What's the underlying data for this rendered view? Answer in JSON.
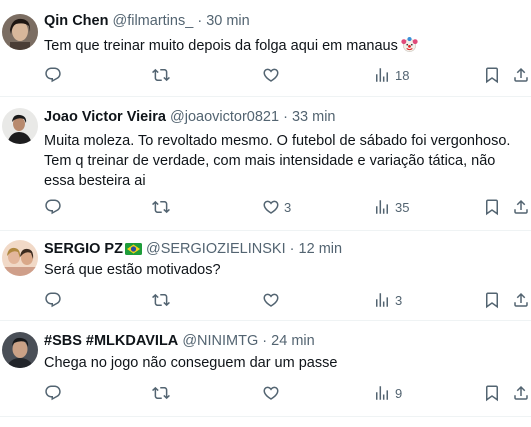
{
  "tweets": [
    {
      "name": "Qin Chen",
      "handle": "@filmartins_",
      "separator": "·",
      "time": "30 min",
      "text": "Tem que treinar muito depois da folga aqui em manaus",
      "emoji": "clown-face",
      "replies": "",
      "retweets": "",
      "likes": "",
      "views": "18"
    },
    {
      "name": "Joao Victor Vieira",
      "handle": "@joaovictor0821",
      "separator": "·",
      "time": "33 min",
      "text": "Muita moleza. To revoltado mesmo. O futebol de sábado foi vergonhoso. Tem q treinar de verdade, com mais intensidade e variação tática, não essa besteira ai",
      "replies": "",
      "retweets": "",
      "likes": "3",
      "views": "35"
    },
    {
      "name": "SERGIO PZ",
      "flag": "brazil-flag",
      "handle": "@SERGIOZIELINSKI",
      "separator": "·",
      "time": "12 min",
      "text": "Será que estão motivados?",
      "replies": "",
      "retweets": "",
      "likes": "",
      "views": "3"
    },
    {
      "name": "#SBS #MLKDAVILA",
      "handle": "@NINIMTG",
      "separator": "·",
      "time": "24 min",
      "text": "Chega no jogo não conseguem dar um passe",
      "replies": "",
      "retweets": "",
      "likes": "",
      "views": "9"
    }
  ],
  "icons": {
    "reply": "reply-icon",
    "retweet": "retweet-icon",
    "like": "heart-icon",
    "views": "views-chart-icon",
    "bookmark": "bookmark-icon",
    "share": "share-icon"
  },
  "colors": {
    "icon_gray": "#536471",
    "text": "#0f1419",
    "divider": "#eff3f4"
  }
}
